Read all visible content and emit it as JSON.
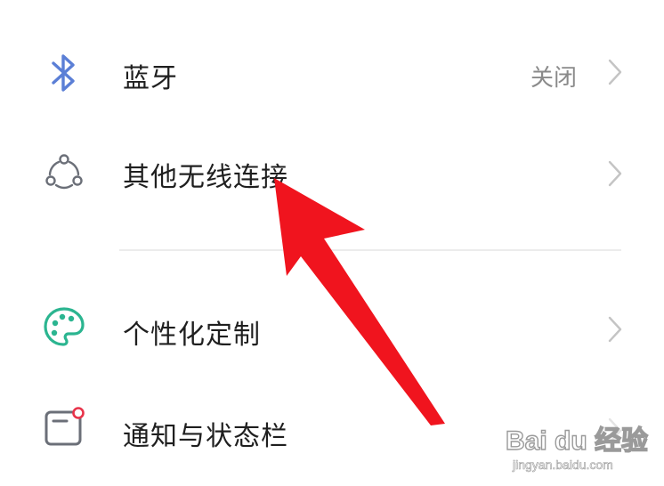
{
  "settings": {
    "items": [
      {
        "label": "蓝牙",
        "value": "关闭",
        "icon": "bluetooth-icon"
      },
      {
        "label": "其他无线连接",
        "value": "",
        "icon": "wireless-connections-icon"
      },
      {
        "label": "个性化定制",
        "value": "",
        "icon": "palette-icon"
      },
      {
        "label": "通知与状态栏",
        "value": "",
        "icon": "notification-icon"
      }
    ]
  },
  "colors": {
    "icon_blue": "#5b7fd6",
    "icon_gray": "#6b6f78",
    "icon_green": "#2bb590",
    "notification_dot": "#e8334a",
    "annotation_arrow": "#f0141e"
  },
  "watermark": {
    "brand": "Bai du 经验",
    "url": "jingyan.baidu.com"
  }
}
